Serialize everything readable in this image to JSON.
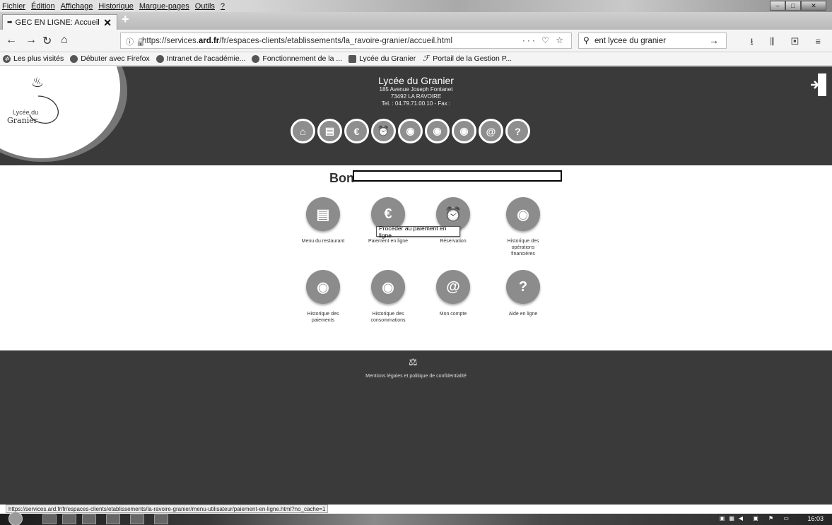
{
  "browser": {
    "menu": [
      "Fichier",
      "Édition",
      "Affichage",
      "Historique",
      "Marque-pages",
      "Outils",
      "?"
    ],
    "tab_title": "GEC EN LIGNE: Accueil",
    "url_prefix": "https://services.",
    "url_domain": "ard.fr",
    "url_path": "/fr/espaces-clients/etablissements/la_ravoire-granier/accueil.html",
    "search_value": "ent lycee du granier",
    "bookmarks": [
      "Les plus visités",
      "Débuter avec Firefox",
      "Intranet de l'académie...",
      "Fonctionnement de la ...",
      "Lycée du Granier",
      "Portail de la Gestion P..."
    ],
    "status_url": "https://services.ard.fr/fr/espaces-clients/etablissements/la-ravoire-granier/menu-utilisateur/paiement-en-ligne.html?no_cache=1"
  },
  "header": {
    "logo_small": "Lycée du",
    "logo_big": "Granier",
    "school_name": "Lycée du Granier",
    "address_1": "185 Avenue Joseph Fontanet",
    "address_2": "73492 LA RAVOIRE",
    "phone": "Tel. : 04.79.71.00.10 - Fax :"
  },
  "main": {
    "greeting": "Bon",
    "tiles": [
      {
        "label": "Menu du restaurant",
        "icon": "menu-icon"
      },
      {
        "label": "Paiement en ligne",
        "icon": "euro-icon"
      },
      {
        "label": "Réservation",
        "icon": "reservation-icon"
      },
      {
        "label": "Historique des opérations financières",
        "icon": "eye-icon"
      },
      {
        "label": "Historique des paiements",
        "icon": "eye-card-icon"
      },
      {
        "label": "Historique des consommations",
        "icon": "eye-calendar-icon"
      },
      {
        "label": "Mon compte",
        "icon": "account-icon"
      },
      {
        "label": "Aide en ligne",
        "icon": "help-icon"
      }
    ],
    "tooltip": "Procéder au paiement en ligne"
  },
  "footer": {
    "legal": "Mentions légales et politique de confidentialité"
  },
  "taskbar": {
    "clock": "16:03"
  }
}
